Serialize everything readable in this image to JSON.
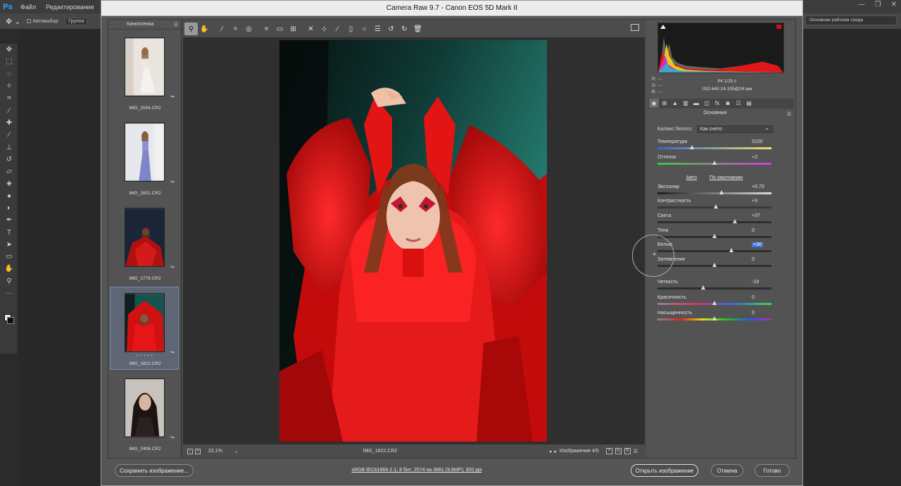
{
  "ps": {
    "logo": "Ps",
    "menu": [
      "Файл",
      "Редактирование",
      "И"
    ],
    "options": {
      "auto_select": "Автовыбор:",
      "group": "Группа"
    },
    "workspace": "Основная рабочая среда"
  },
  "acr": {
    "title": "Camera Raw 9.7  -  Canon EOS 5D Mark II",
    "filmstrip": {
      "header": "Кинопленка",
      "items": [
        {
          "name": "IMG_1594.CR2",
          "selected": false
        },
        {
          "name": "IMG_1601.CR2",
          "selected": false
        },
        {
          "name": "IMG_1779.CR2",
          "selected": false
        },
        {
          "name": "IMG_1822.CR2",
          "selected": true,
          "stars": "• • • • •"
        },
        {
          "name": "IMG_2406.CR2",
          "selected": false
        }
      ]
    },
    "canvas": {
      "zoom": "22,1%",
      "filename": "IMG_1822.CR2",
      "image_counter": "Изображение 4/5"
    },
    "info": {
      "r": "R:  ---",
      "g": "G:  ---",
      "b": "B:  ---",
      "exposure": "f/4     1/25 с",
      "iso_lens": "ISO 640    24-105@24 мм"
    },
    "panel": {
      "title": "Основные",
      "wb_label": "Баланс белого:",
      "wb_value": "Как снято",
      "auto": "Авто",
      "default": "По умолчанию",
      "sliders": [
        {
          "label": "Температура",
          "value": "5100",
          "pos": 0.3
        },
        {
          "label": "Оттенок",
          "value": "+2",
          "pos": 0.5
        },
        {
          "label": "Экспонир",
          "value": "+0.70",
          "pos": 0.56
        },
        {
          "label": "Контрастность",
          "value": "+3",
          "pos": 0.51
        },
        {
          "label": "Света",
          "value": "+37",
          "pos": 0.68
        },
        {
          "label": "Тени",
          "value": "0",
          "pos": 0.5
        },
        {
          "label": "Белые",
          "value": "+30",
          "pos": 0.65,
          "highlight": true
        },
        {
          "label": "Затемнение",
          "value": "0",
          "pos": 0.5
        },
        {
          "label": "Четкость",
          "value": "-19",
          "pos": 0.4
        },
        {
          "label": "Красочность",
          "value": "0",
          "pos": 0.5
        },
        {
          "label": "Насыщенность",
          "value": "0",
          "pos": 0.5
        }
      ]
    },
    "bottom": {
      "save": "Сохранить изображение...",
      "workflow": "sRGB IEC61966-2.1; 8 бит; 2574 на 3861 (9,9МР); 300 ppi",
      "open": "Открыть изображение",
      "cancel": "Отмена",
      "done": "Готово"
    }
  }
}
